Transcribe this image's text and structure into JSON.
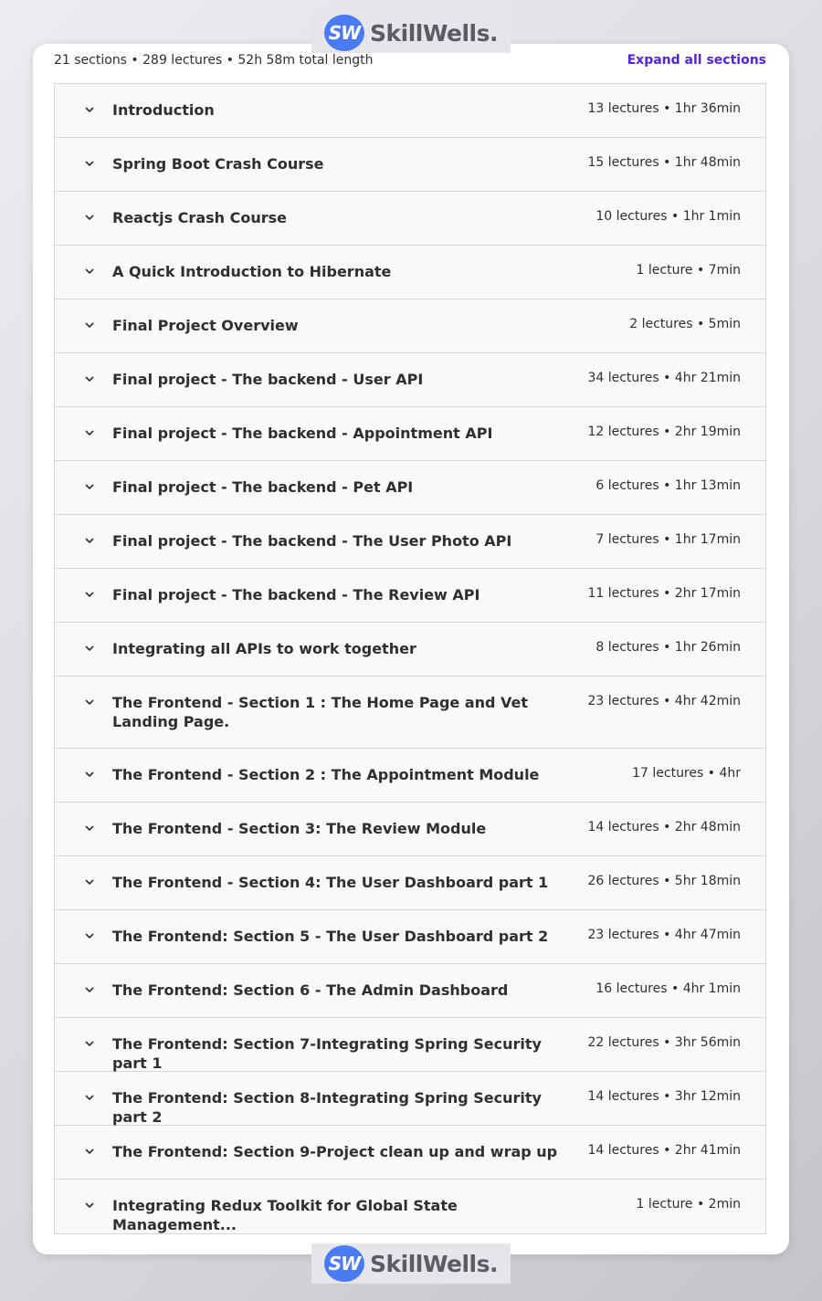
{
  "brand": {
    "logo_badge": "SW",
    "logo_text": "SkillWells."
  },
  "course": {
    "summary": "21 sections • 289 lectures • 52h 58m total length",
    "expand_all_label": "Expand all sections"
  },
  "sections": [
    {
      "title": "Introduction",
      "meta": "13 lectures • 1hr 36min"
    },
    {
      "title": "Spring Boot Crash Course",
      "meta": "15 lectures • 1hr 48min"
    },
    {
      "title": "Reactjs Crash Course",
      "meta": "10 lectures • 1hr 1min"
    },
    {
      "title": "A Quick Introduction to Hibernate",
      "meta": "1 lecture • 7min"
    },
    {
      "title": "Final Project Overview",
      "meta": "2 lectures • 5min"
    },
    {
      "title": "Final project - The backend - User API",
      "meta": "34 lectures • 4hr 21min"
    },
    {
      "title": "Final project - The backend - Appointment API",
      "meta": "12 lectures • 2hr 19min"
    },
    {
      "title": "Final project - The backend - Pet API",
      "meta": "6 lectures • 1hr 13min"
    },
    {
      "title": "Final project - The backend - The User Photo API",
      "meta": "7 lectures • 1hr 17min"
    },
    {
      "title": "Final project - The backend - The Review API",
      "meta": "11 lectures • 2hr 17min"
    },
    {
      "title": "Integrating all APIs to work together",
      "meta": "8 lectures • 1hr 26min"
    },
    {
      "title": "The Frontend - Section 1 : The Home Page and Vet Landing Page.",
      "meta": "23 lectures • 4hr 42min"
    },
    {
      "title": "The Frontend - Section 2 : The Appointment Module",
      "meta": "17 lectures • 4hr"
    },
    {
      "title": "The Frontend - Section 3: The Review Module",
      "meta": "14 lectures • 2hr 48min"
    },
    {
      "title": "The Frontend - Section 4: The User Dashboard part 1",
      "meta": "26 lectures • 5hr 18min"
    },
    {
      "title": "The Frontend: Section 5 - The User Dashboard part 2",
      "meta": "23 lectures • 4hr 47min"
    },
    {
      "title": "The Frontend: Section 6 - The Admin Dashboard",
      "meta": "16 lectures • 4hr 1min"
    },
    {
      "title": "The Frontend: Section 7-Integrating Spring Security part 1",
      "meta": "22 lectures • 3hr 56min"
    },
    {
      "title": "The Frontend: Section 8-Integrating Spring Security part 2",
      "meta": "14 lectures • 3hr 12min"
    },
    {
      "title": "The Frontend: Section 9-Project clean up and wrap up",
      "meta": "14 lectures • 2hr 41min"
    },
    {
      "title": "Integrating Redux Toolkit for Global State Management...",
      "meta": "1 lecture • 2min"
    }
  ]
}
